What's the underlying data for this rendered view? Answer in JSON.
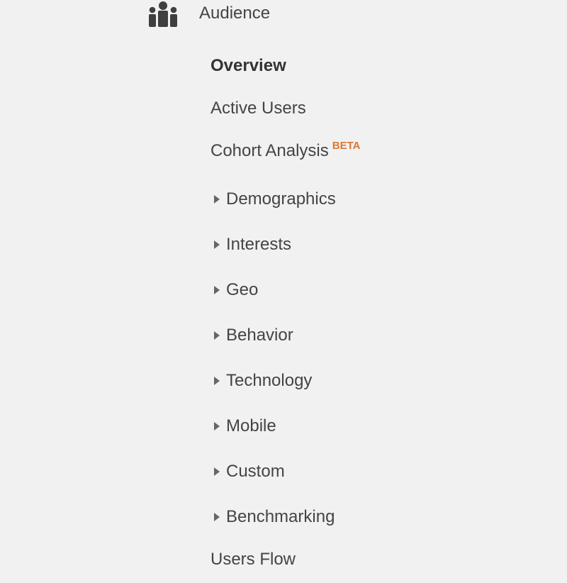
{
  "section": {
    "title": "Audience",
    "icon": "audience-people-icon"
  },
  "nav": {
    "items": [
      {
        "label": "Overview",
        "active": true,
        "expandable": false
      },
      {
        "label": "Active Users",
        "active": false,
        "expandable": false
      },
      {
        "label": "Cohort Analysis",
        "active": false,
        "expandable": false,
        "badge": "BETA"
      },
      {
        "label": "Demographics",
        "active": false,
        "expandable": true
      },
      {
        "label": "Interests",
        "active": false,
        "expandable": true
      },
      {
        "label": "Geo",
        "active": false,
        "expandable": true
      },
      {
        "label": "Behavior",
        "active": false,
        "expandable": true
      },
      {
        "label": "Technology",
        "active": false,
        "expandable": true
      },
      {
        "label": "Mobile",
        "active": false,
        "expandable": true
      },
      {
        "label": "Custom",
        "active": false,
        "expandable": true
      },
      {
        "label": "Benchmarking",
        "active": false,
        "expandable": true
      },
      {
        "label": "Users Flow",
        "active": false,
        "expandable": false
      }
    ]
  },
  "colors": {
    "background": "#f1f1f1",
    "text": "#444444",
    "badge": "#dd7732",
    "caret": "#666666"
  }
}
